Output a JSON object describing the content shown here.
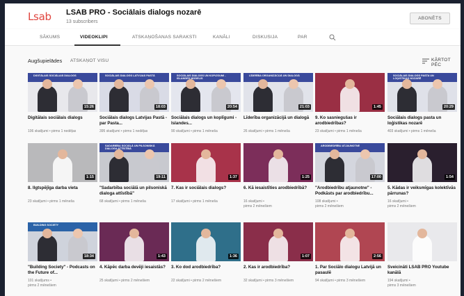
{
  "channel": {
    "logo_text": "Lsab",
    "title": "LSAB PRO - Sociālais dialogs nozarē",
    "subscribers": "13 subscribers",
    "subscribe_label": "ABONĒTS"
  },
  "tabs": [
    {
      "label": "SĀKUMS",
      "active": false
    },
    {
      "label": "VIDEOKLIPI",
      "active": true
    },
    {
      "label": "ATSKAŅOŠANAS SARAKSTI",
      "active": false
    },
    {
      "label": "KANĀLI",
      "active": false
    },
    {
      "label": "DISKUSIJA",
      "active": false
    },
    {
      "label": "PAR",
      "active": false
    }
  ],
  "section": {
    "title": "Augšupielādes",
    "play_all": "ATSKAŅOT VISU",
    "sort_label": "KĀRTOT PĒC"
  },
  "videos": [
    {
      "title": "Digitālais sociālais dialogs",
      "meta1": "106 skatījumi • pirms 1 nedēļas",
      "meta2": "",
      "duration": "15:26",
      "band": "#3a4a9c",
      "bg": "#e8e8ec",
      "band_text": "Digitālais sociālais dialogs"
    },
    {
      "title": "Sociālais dialogs Latvijas Pastā - par Pasta...",
      "meta1": "395 skatījumi • pirms 1 nedēļas",
      "meta2": "",
      "duration": "18:03",
      "band": "#3a4a9c",
      "bg": "#d9dbe6",
      "band_text": "Sociālais dialogs Latvijas Pastā"
    },
    {
      "title": "Sociālais dialogs un koplīgumi - Islandes...",
      "meta1": "90 skatījumi • pirms 1 mēneša",
      "meta2": "",
      "duration": "20:54",
      "band": "#3a4a9c",
      "bg": "#e4e6ee",
      "band_text": "Sociālais dialogs un koplīgumi - Islandes modelis"
    },
    {
      "title": "Līderība organizācijā un dialogā",
      "meta1": "26 skatījumi • pirms 1 mēneša",
      "meta2": "",
      "duration": "21:03",
      "band": "#3a4a9c",
      "bg": "#e1e3ea",
      "band_text": "Līderība organizācijā un dialogā"
    },
    {
      "title": "9. Ko sasniegušas ir arodbiedrības?",
      "meta1": "23 skatījumi • pirms 1 mēneša",
      "meta2": "",
      "duration": "1:45",
      "band": "",
      "bg": "#9a2f44",
      "band_text": ""
    },
    {
      "title": "Sociālais dialogs pasta un loģistikas nozarē",
      "meta1": "403 skatījumi • pirms 1 mēneša",
      "meta2": "",
      "duration": "20:29",
      "band": "#3a4a9c",
      "bg": "#dfe1e9",
      "band_text": "Sociālais dialogs pasta un loģistikas nozarē"
    },
    {
      "title": "8. Ilgtspējīga darba vieta",
      "meta1": "23 skatījumi • pirms 1 mēneša",
      "meta2": "",
      "duration": "1:15",
      "band": "",
      "bg": "#b9b9bb",
      "band_text": ""
    },
    {
      "title": "\"Sadarbība sociālā un pilsoniskā dialoga attīstībā\"",
      "meta1": "68 skatījumi • pirms 1 mēneša",
      "meta2": "",
      "duration": "19:11",
      "band": "#3a4a9c",
      "bg": "#c8c9cf",
      "band_text": "Sadarbība sociālā un pilsoniskā dialoga attīstībā"
    },
    {
      "title": "7. Kas ir sociālais dialogs?",
      "meta1": "17 skatījumi • pirms 1 mēneša",
      "meta2": "",
      "duration": "1:37",
      "band": "",
      "bg": "#a8334a",
      "band_text": ""
    },
    {
      "title": "6. Kā iesaistīties arodbiedrībā?",
      "meta1": "16 skatījumi •",
      "meta2": "pirms 2 mēnešiem",
      "duration": "1:25",
      "band": "",
      "bg": "#7c2e5a",
      "band_text": ""
    },
    {
      "title": "\"Arodbiedrību atjaunotne\" - Podkāsts par arodbiedrību...",
      "meta1": "108 skatījumi •",
      "meta2": "pirms 2 mēnešiem",
      "duration": "17:00",
      "band": "#3a4a9c",
      "bg": "#d4d6de",
      "band_text": "Arodbiedrību atjaunotne"
    },
    {
      "title": "5. Kādas ir veiksmīgas kolektīvās pārrunas?",
      "meta1": "16 skatījumi •",
      "meta2": "pirms 2 mēnešiem",
      "duration": "1:54",
      "band": "",
      "bg": "#2a1f2e",
      "band_text": ""
    },
    {
      "title": "\"Building Society\" - Podcasts on the Future of...",
      "meta1": "101 skatījums •",
      "meta2": "pirms 2 mēnešiem",
      "duration": "18:34",
      "band": "#2b63a8",
      "bg": "#cfd3dc",
      "band_text": "Building Society"
    },
    {
      "title": "4. Kāpēc darba devēji iesaistās?",
      "meta1": "25 skatījumi • pirms 2 mēnešiem",
      "meta2": "",
      "duration": "1:43",
      "band": "",
      "bg": "#6a2a55",
      "band_text": ""
    },
    {
      "title": "3. Ko dod arodbiedrība?",
      "meta1": "22 skatījumi • pirms 2 mēnešiem",
      "meta2": "",
      "duration": "1:36",
      "band": "",
      "bg": "#2f6f8a",
      "band_text": ""
    },
    {
      "title": "2. Kas ir arodbiedrība?",
      "meta1": "32 skatījumi • pirms 3 mēnešiem",
      "meta2": "",
      "duration": "1:07",
      "band": "",
      "bg": "#8a2e4a",
      "band_text": ""
    },
    {
      "title": "1. Par Sociālo dialogu Latvijā un pasaulē",
      "meta1": "94 skatījumi • pirms 3 mēnešiem",
      "meta2": "",
      "duration": "2:56",
      "band": "",
      "bg": "#b04652",
      "band_text": ""
    },
    {
      "title": "Sveicināti LSAB PRO Youtube kanālā",
      "meta1": "194 skatījumi •",
      "meta2": "pirms 3 mēnešiem",
      "duration": "",
      "band": "",
      "bg": "#e9e9ec",
      "band_text": ""
    }
  ],
  "colors": {
    "brand_red": "#e0443e",
    "band_blue": "#3a4a9c"
  }
}
